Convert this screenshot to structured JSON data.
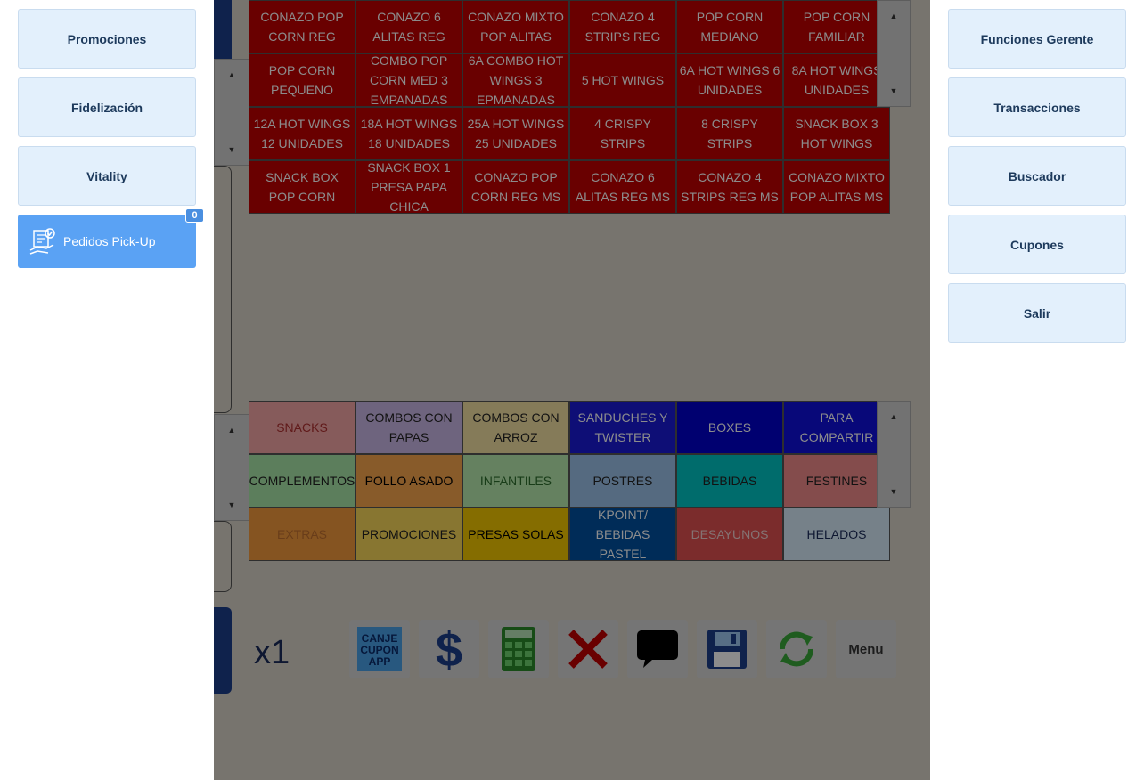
{
  "left_menu": {
    "items": [
      {
        "label": "Promociones"
      },
      {
        "label": "Fidelización"
      },
      {
        "label": "Vitality"
      }
    ],
    "pickup": {
      "label": "Pedidos Pick-Up",
      "badge": "0"
    }
  },
  "right_menu": {
    "items": [
      {
        "label": "Funciones Gerente"
      },
      {
        "label": "Transacciones"
      },
      {
        "label": "Buscador"
      },
      {
        "label": "Cupones"
      },
      {
        "label": "Salir"
      }
    ]
  },
  "products": [
    {
      "label": "CONAZO POP CORN REG"
    },
    {
      "label": "CONAZO 6 ALITAS REG"
    },
    {
      "label": "CONAZO MIXTO POP ALITAS"
    },
    {
      "label": "CONAZO 4 STRIPS REG"
    },
    {
      "label": "POP CORN MEDIANO"
    },
    {
      "label": "POP CORN FAMILIAR"
    },
    {
      "label": "POP CORN PEQUENO"
    },
    {
      "label": "COMBO POP CORN MED 3 EMPANADAS"
    },
    {
      "label": "6A COMBO HOT WINGS 3 EPMANADAS"
    },
    {
      "label": "5 HOT WINGS"
    },
    {
      "label": "6A HOT WINGS 6 UNIDADES"
    },
    {
      "label": "8A HOT WINGS UNIDADES"
    },
    {
      "label": "12A HOT WINGS 12 UNIDADES"
    },
    {
      "label": "18A HOT WINGS 18 UNIDADES"
    },
    {
      "label": "25A HOT WINGS 25 UNIDADES"
    },
    {
      "label": "4 CRISPY STRIPS"
    },
    {
      "label": "8 CRISPY STRIPS"
    },
    {
      "label": "SNACK BOX 3 HOT WINGS"
    },
    {
      "label": "SNACK BOX POP CORN"
    },
    {
      "label": "SNACK BOX 1 PRESA PAPA CHICA"
    },
    {
      "label": "CONAZO POP CORN REG MS"
    },
    {
      "label": "CONAZO 6 ALITAS REG MS"
    },
    {
      "label": "CONAZO 4 STRIPS REG MS"
    },
    {
      "label": "CONAZO MIXTO POP ALITAS MS"
    }
  ],
  "categories": [
    {
      "label": "SNACKS",
      "bg": "#f4a6a6",
      "fg": "#b03030"
    },
    {
      "label": "COMBOS CON PAPAS",
      "bg": "#c9b6e6",
      "fg": "#222222"
    },
    {
      "label": "COMBOS CON ARROZ",
      "bg": "#f3e0a3",
      "fg": "#222222"
    },
    {
      "label": "SANDUCHES Y TWISTER",
      "bg": "#1a1ad8",
      "fg": "#ffffff"
    },
    {
      "label": "BOXES",
      "bg": "#0000cc",
      "fg": "#ffffff"
    },
    {
      "label": "PARA COMPARTIR",
      "bg": "#1010dd",
      "fg": "#ffffff"
    },
    {
      "label": "COMPLEMENTOS",
      "bg": "#a8e6a8",
      "fg": "#222222"
    },
    {
      "label": "POLLO ASADO",
      "bg": "#f7a64e",
      "fg": "#000000"
    },
    {
      "label": "INFANTILES",
      "bg": "#b8ecb0",
      "fg": "#2d6d2d"
    },
    {
      "label": "POSTRES",
      "bg": "#9cc2ea",
      "fg": "#222222"
    },
    {
      "label": "BEBIDAS",
      "bg": "#00c5c5",
      "fg": "#222222"
    },
    {
      "label": "FESTINES",
      "bg": "#f08a8a",
      "fg": "#222222"
    },
    {
      "label": "EXTRAS",
      "bg": "#f39a3c",
      "fg": "#c07030"
    },
    {
      "label": "PROMOCIONES",
      "bg": "#f8d85a",
      "fg": "#222222"
    },
    {
      "label": "PRESAS SOLAS",
      "bg": "#f2c700",
      "fg": "#000000"
    },
    {
      "label": "KPOINT/ BEBIDAS PASTEL",
      "bg": "#0050a0",
      "fg": "#ffffff"
    },
    {
      "label": "DESAYUNOS",
      "bg": "#e05050",
      "fg": "#f0d0d0"
    },
    {
      "label": "HELADOS",
      "bg": "#d8ecfa",
      "fg": "#1a2b5a"
    }
  ],
  "quantity": "x1",
  "toolbar": {
    "coupon_label": "CANJE CUPON APP",
    "menu_label": "Menu"
  }
}
